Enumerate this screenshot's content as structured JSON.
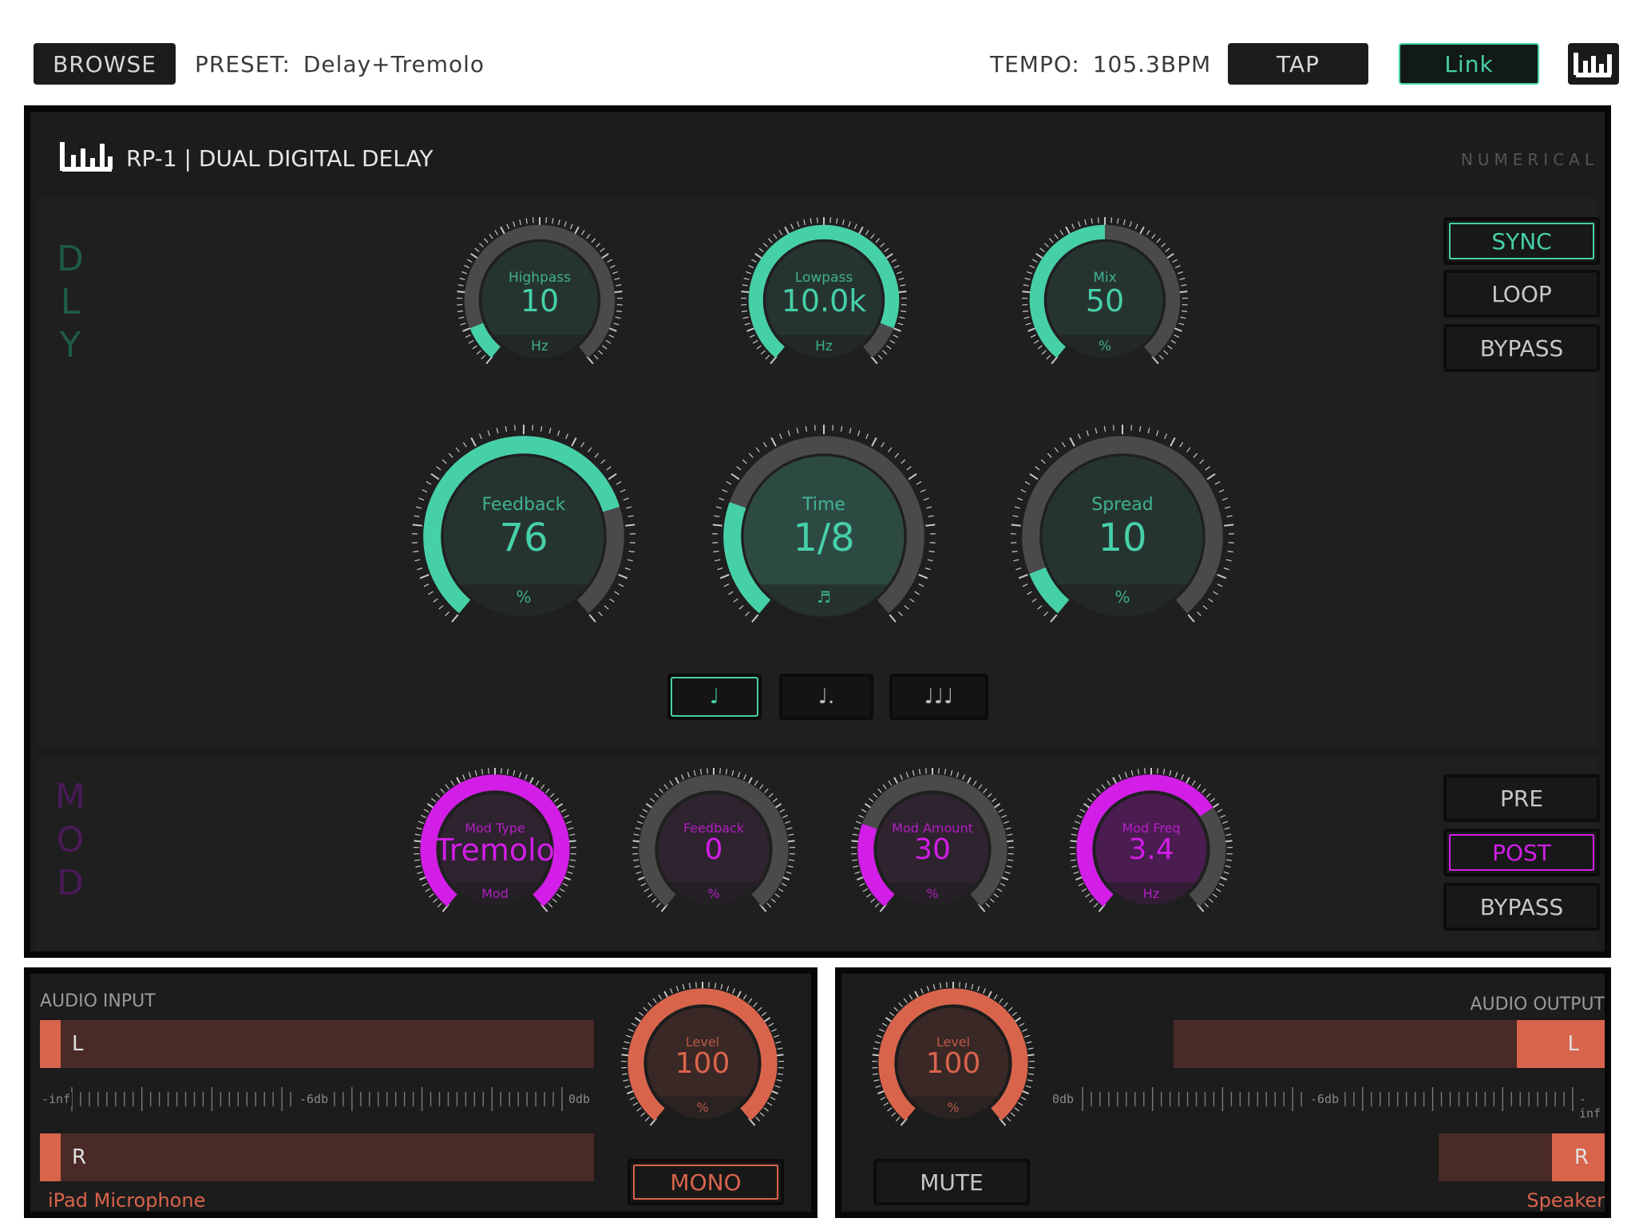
{
  "topbar": {
    "browse_label": "BROWSE",
    "preset_label": "PRESET:",
    "preset_value": "Delay+Tremolo",
    "tempo_label": "TEMPO:",
    "tempo_value": "105.3BPM",
    "tap_label": "TAP",
    "link_label": "Link"
  },
  "plugin": {
    "title": "RP-1 | DUAL DIGITAL DELAY",
    "view_mode": "NUMERICAL"
  },
  "delay": {
    "section_letters": [
      "D",
      "L",
      "Y"
    ],
    "accent_color": "#46d0a8",
    "knobs": [
      {
        "label": "Highpass",
        "value": "10",
        "unit": "Hz",
        "level": 0.1
      },
      {
        "label": "Lowpass",
        "value": "10.0k",
        "unit": "Hz",
        "level": 0.9
      },
      {
        "label": "Mix",
        "value": "50",
        "unit": "%",
        "level": 0.5
      },
      {
        "label": "Feedback",
        "value": "76",
        "unit": "%",
        "level": 0.76
      },
      {
        "label": "Time",
        "value": "1/8",
        "unit": "♬",
        "level": 0.25
      },
      {
        "label": "Spread",
        "value": "10",
        "unit": "%",
        "level": 0.1
      }
    ],
    "buttons": {
      "sync": "SYNC",
      "loop": "LOOP",
      "bypass": "BYPASS"
    },
    "note_modes": [
      "♩",
      "♩.",
      "♩♩♩"
    ]
  },
  "mod": {
    "section_letters": [
      "M",
      "O",
      "D"
    ],
    "accent_color": "#d21ee6",
    "knobs": [
      {
        "label": "Mod Type",
        "value": "Tremolo",
        "unit": "Mod",
        "level": 1.0
      },
      {
        "label": "Feedback",
        "value": "0",
        "unit": "%",
        "level": 0.0
      },
      {
        "label": "Mod Amount",
        "value": "30",
        "unit": "%",
        "level": 0.25
      },
      {
        "label": "Mod Freq",
        "value": "3.4",
        "unit": "Hz",
        "level": 0.7
      }
    ],
    "buttons": {
      "pre": "PRE",
      "post": "POST",
      "bypass": "BYPASS"
    }
  },
  "audio_input": {
    "title": "AUDIO INPUT",
    "channel_l": "L",
    "channel_r": "R",
    "scale": [
      "-inf",
      "-6db",
      "0db"
    ],
    "level_knob": {
      "label": "Level",
      "value": "100",
      "unit": "%",
      "level": 1.0
    },
    "mono_label": "MONO",
    "device": "iPad Microphone",
    "accent_color": "#d9644c"
  },
  "audio_output": {
    "title": "AUDIO OUTPUT",
    "channel_l": "L",
    "channel_r": "R",
    "scale": [
      "0db",
      "-6db",
      "-inf"
    ],
    "level_knob": {
      "label": "Level",
      "value": "100",
      "unit": "%",
      "level": 1.0
    },
    "mute_label": "MUTE",
    "device": "Speaker"
  }
}
